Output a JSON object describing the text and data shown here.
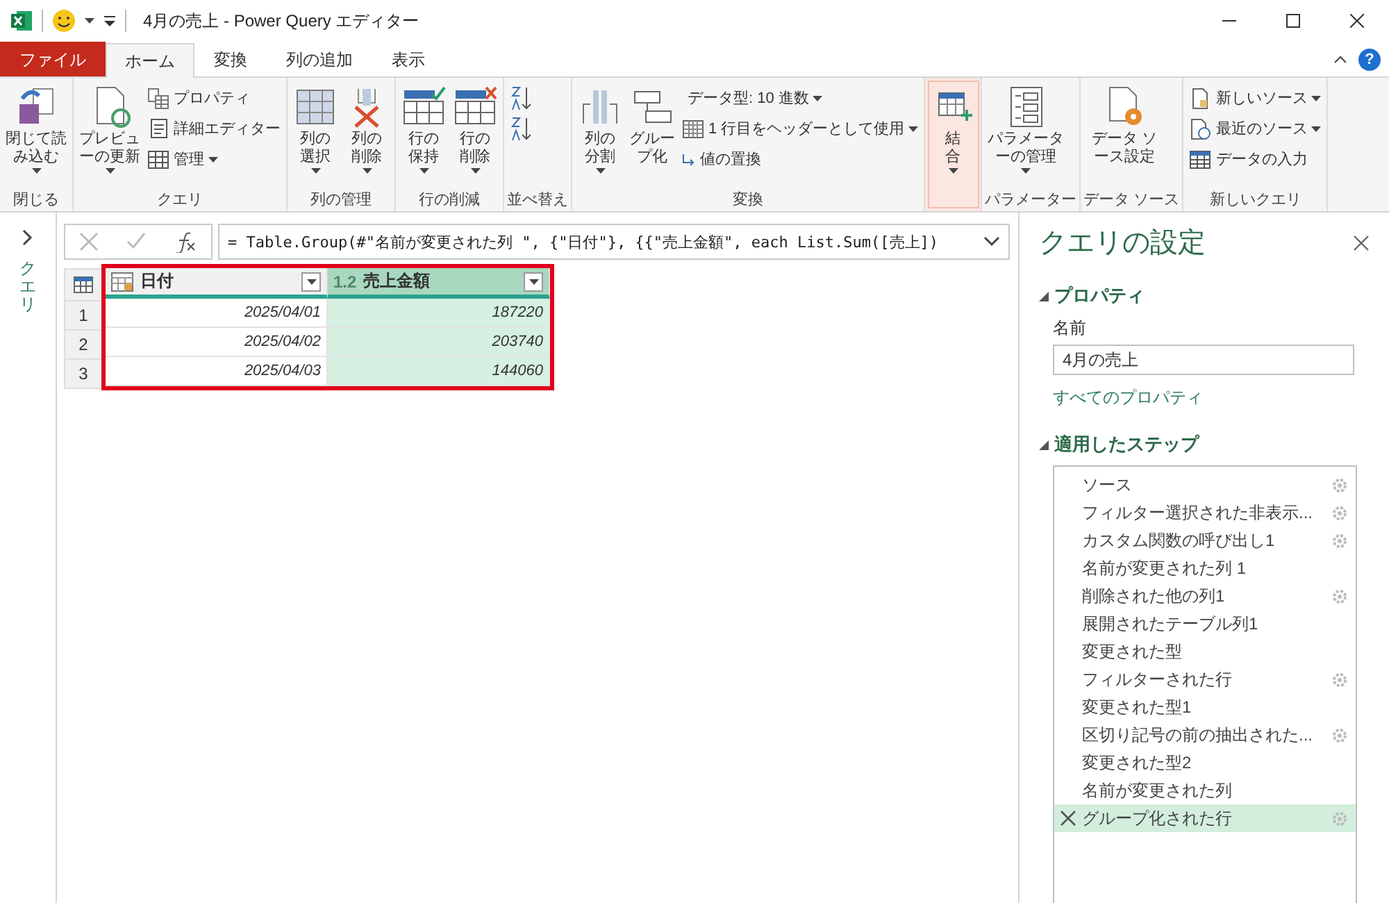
{
  "window": {
    "title": "4月の売上 - Power Query エディター"
  },
  "tabs": [
    {
      "label": "ファイル",
      "kind": "file",
      "selected": false
    },
    {
      "label": "ホーム",
      "kind": "tab",
      "selected": true
    },
    {
      "label": "変換",
      "kind": "tab",
      "selected": false
    },
    {
      "label": "列の追加",
      "kind": "tab",
      "selected": false
    },
    {
      "label": "表示",
      "kind": "tab",
      "selected": false
    }
  ],
  "help": "?",
  "ribbon": [
    {
      "label": "閉じる",
      "highlighted": false,
      "items": [
        {
          "kind": "large",
          "label": "閉じて読み込む",
          "dropdown": true
        }
      ]
    },
    {
      "label": "クエリ",
      "highlighted": false,
      "items": [
        {
          "kind": "large",
          "label": "プレビューの更新",
          "dropdown": true
        },
        {
          "kind": "small",
          "label": "プロパティ",
          "dropdown": false
        },
        {
          "kind": "small",
          "label": "詳細エディター",
          "dropdown": false
        },
        {
          "kind": "small",
          "label": "管理",
          "dropdown": true
        }
      ]
    },
    {
      "label": "列の管理",
      "highlighted": false,
      "items": [
        {
          "kind": "large",
          "label": "列の選択",
          "dropdown": true
        },
        {
          "kind": "large",
          "label": "列の削除",
          "dropdown": true
        }
      ]
    },
    {
      "label": "行の削減",
      "highlighted": false,
      "items": [
        {
          "kind": "large",
          "label": "行の保持",
          "dropdown": true
        },
        {
          "kind": "large",
          "label": "行の削除",
          "dropdown": true
        }
      ]
    },
    {
      "label": "並べ替え",
      "highlighted": false,
      "items": [
        {
          "kind": "icon",
          "dropdown": false
        },
        {
          "kind": "icon",
          "dropdown": false
        }
      ]
    },
    {
      "label": "変換",
      "highlighted": false,
      "items": [
        {
          "kind": "large",
          "label": "列の分割",
          "dropdown": true
        },
        {
          "kind": "large",
          "label": "グループ化",
          "dropdown": false
        },
        {
          "kind": "small",
          "label": "データ型: 10 進数",
          "dropdown": true
        },
        {
          "kind": "small",
          "label": "1 行目をヘッダーとして使用",
          "dropdown": true
        },
        {
          "kind": "small",
          "label": "値の置換",
          "dropdown": false
        }
      ]
    },
    {
      "highlighted": true,
      "items": [
        {
          "kind": "large",
          "label": "結合",
          "dropdown": true
        }
      ]
    },
    {
      "label": "パラメーター",
      "highlighted": false,
      "items": [
        {
          "kind": "large",
          "label": "パラメーターの管理",
          "dropdown": true
        }
      ]
    },
    {
      "label": "データ ソース",
      "highlighted": false,
      "items": [
        {
          "kind": "large",
          "label": "データ ソース設定",
          "dropdown": false
        }
      ]
    },
    {
      "label": "新しいクエリ",
      "highlighted": false,
      "items": [
        {
          "kind": "small",
          "label": "新しいソース",
          "dropdown": true
        },
        {
          "kind": "small",
          "label": "最近のソース",
          "dropdown": true
        },
        {
          "kind": "small",
          "label": "データの入力",
          "dropdown": false
        }
      ]
    }
  ],
  "queries_pane": {
    "label": "クエリ"
  },
  "formula": "= Table.Group(#\"名前が変更された列 \", {\"日付\"}, {{\"売上金額\", each List.Sum([売上])",
  "table": {
    "highlighted": true,
    "columns": [
      {
        "kind": "date",
        "name": "日付",
        "selected": false
      },
      {
        "kind": "number",
        "type_label": "1.2",
        "name": "売上金額",
        "selected": true
      }
    ],
    "rows": [
      {
        "number": "1",
        "cells": [
          "2025/04/01",
          "187220"
        ]
      },
      {
        "number": "2",
        "cells": [
          "2025/04/02",
          "203740"
        ]
      },
      {
        "number": "3",
        "cells": [
          "2025/04/03",
          "144060"
        ]
      }
    ]
  },
  "settings": {
    "title": "クエリの設定",
    "properties": {
      "heading": "プロパティ",
      "name_label": "名前",
      "name_value": "4月の売上",
      "link": "すべてのプロパティ"
    },
    "steps_heading": "適用したステップ",
    "steps": [
      {
        "name": "ソース",
        "has_settings": true,
        "selected": false
      },
      {
        "name": "フィルター選択された非表示...",
        "has_settings": true,
        "selected": false
      },
      {
        "name": "カスタム関数の呼び出し1",
        "has_settings": true,
        "selected": false
      },
      {
        "name": "名前が変更された列 1",
        "has_settings": false,
        "selected": false
      },
      {
        "name": "削除された他の列1",
        "has_settings": true,
        "selected": false
      },
      {
        "name": "展開されたテーブル列1",
        "has_settings": false,
        "selected": false
      },
      {
        "name": "変更された型",
        "has_settings": false,
        "selected": false
      },
      {
        "name": "フィルターされた行",
        "has_settings": true,
        "selected": false
      },
      {
        "name": "変更された型1",
        "has_settings": false,
        "selected": false
      },
      {
        "name": "区切り記号の前の抽出された...",
        "has_settings": true,
        "selected": false
      },
      {
        "name": "変更された型2",
        "has_settings": false,
        "selected": false
      },
      {
        "name": "名前が変更された列",
        "has_settings": false,
        "selected": false
      },
      {
        "name": "グループ化された行",
        "has_settings": true,
        "selected": true
      }
    ]
  }
}
